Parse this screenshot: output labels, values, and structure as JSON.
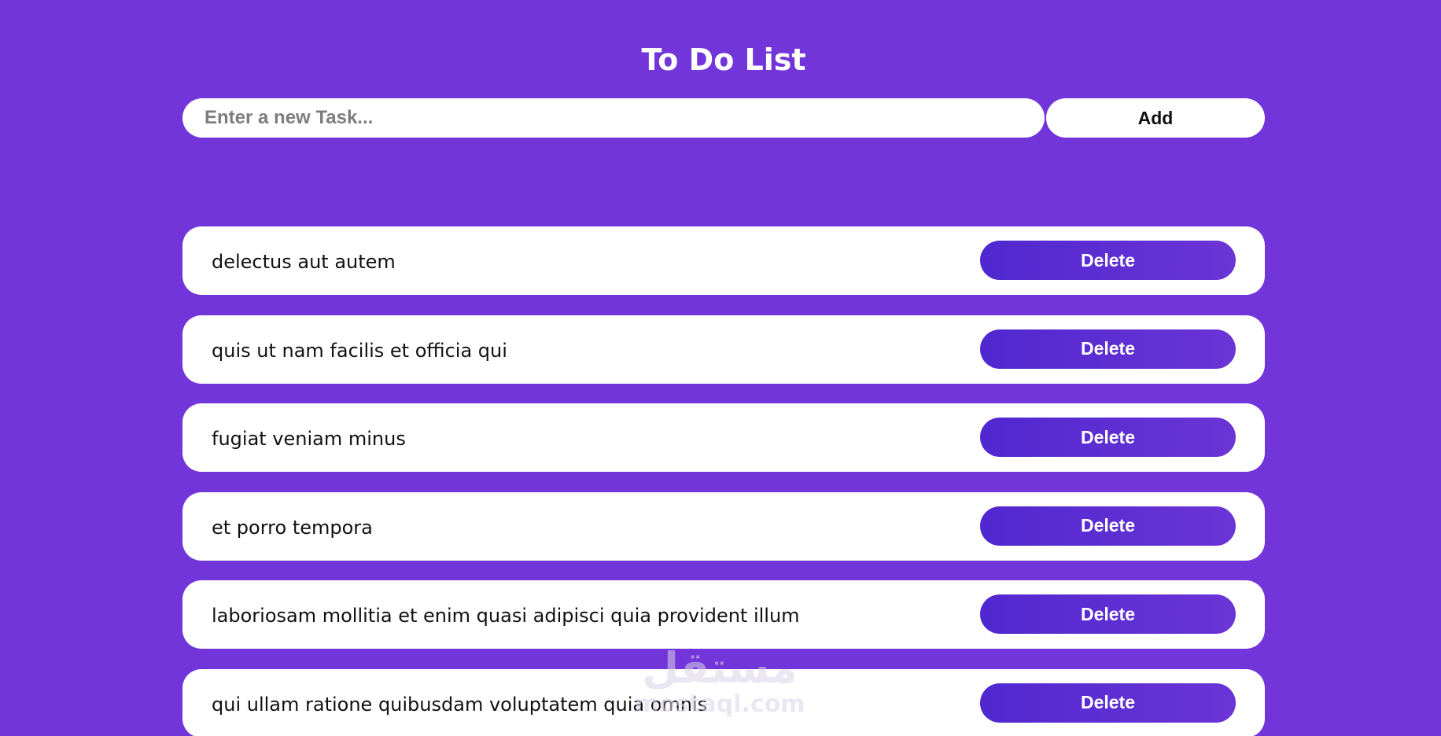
{
  "header": {
    "title": "To Do List"
  },
  "new_task": {
    "value": "",
    "placeholder": "Enter a new Task...",
    "add_label": "Add"
  },
  "tasks": [
    {
      "text": "delectus aut autem",
      "delete_label": "Delete"
    },
    {
      "text": "quis ut nam facilis et officia qui",
      "delete_label": "Delete"
    },
    {
      "text": "fugiat veniam minus",
      "delete_label": "Delete"
    },
    {
      "text": "et porro tempora",
      "delete_label": "Delete"
    },
    {
      "text": "laboriosam mollitia et enim quasi adipisci quia provident illum",
      "delete_label": "Delete"
    },
    {
      "text": "qui ullam ratione quibusdam voluptatem quia omnis",
      "delete_label": "Delete"
    }
  ],
  "watermark": {
    "arabic": "مستقل",
    "latin": "mostaql.com"
  },
  "colors": {
    "background": "#7235d9",
    "card": "#ffffff",
    "delete_gradient_start": "#5028cf",
    "delete_gradient_end": "#6b34d6"
  }
}
